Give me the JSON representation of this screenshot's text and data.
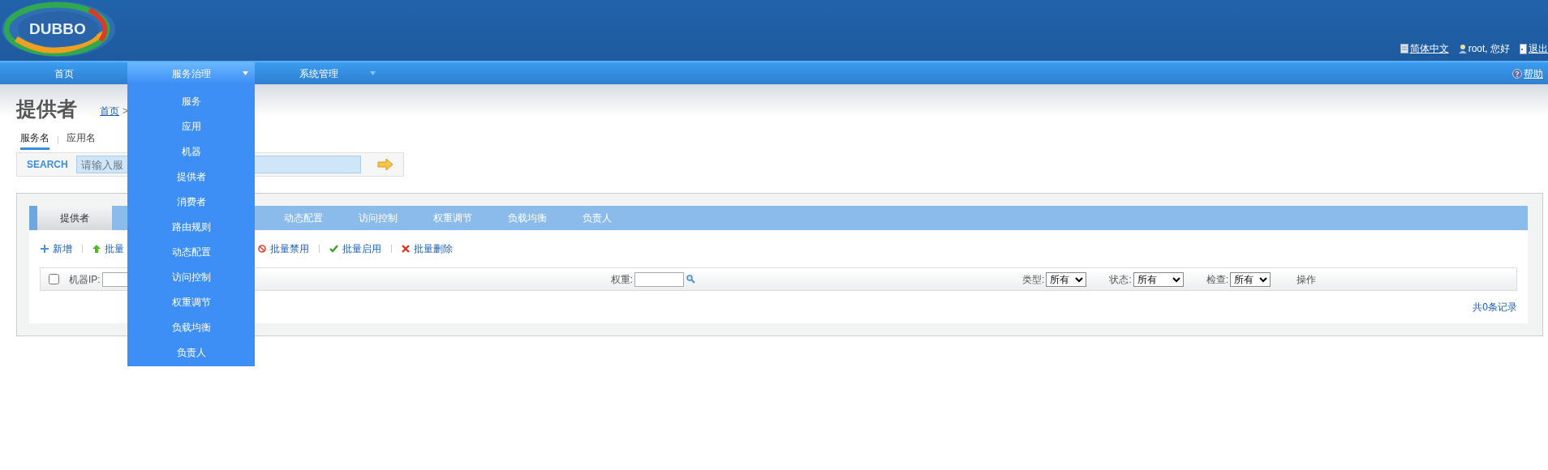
{
  "logo": {
    "text": "DUBBO"
  },
  "header_links": [
    {
      "kind": "doc",
      "label": "简体中文",
      "link": true
    },
    {
      "kind": "user",
      "label": "root, 您好",
      "link": false
    },
    {
      "kind": "exit",
      "label": "退出",
      "link": true
    }
  ],
  "nav": [
    {
      "label": "首页",
      "selected": false,
      "has_menu": false
    },
    {
      "label": "服务治理",
      "selected": true,
      "has_menu": true
    },
    {
      "label": "系统管理",
      "selected": false,
      "has_menu": true
    }
  ],
  "help": "帮助",
  "dropdown": [
    "服务",
    "应用",
    "机器",
    "提供者",
    "消费者",
    "路由规则",
    "动态配置",
    "访问控制",
    "权重调节",
    "负载均衡",
    "负责人"
  ],
  "page_title": "提供者",
  "breadcrumb": {
    "home": "首页",
    "separator": ">"
  },
  "search": {
    "tabs": [
      {
        "label": "服务名",
        "selected": true
      },
      {
        "label": "应用名",
        "selected": false
      }
    ],
    "label": "SEARCH",
    "placeholder": "请输入服"
  },
  "tabs": [
    {
      "label": "提供者",
      "selected": true
    },
    {
      "label": "动态配置",
      "selected": false
    },
    {
      "label": "访问控制",
      "selected": false
    },
    {
      "label": "权重调节",
      "selected": false
    },
    {
      "label": "负载均衡",
      "selected": false
    },
    {
      "label": "负责人",
      "selected": false
    }
  ],
  "actions": [
    {
      "kind": "add",
      "label": "新增"
    },
    {
      "kind": "up",
      "label": "批量"
    },
    {
      "kind": "disable",
      "label": "批量禁用"
    },
    {
      "kind": "enable",
      "label": "批量启用"
    },
    {
      "kind": "delete",
      "label": "批量删除"
    }
  ],
  "filters": {
    "checked": false,
    "ip_label": "机器IP:",
    "weight_label": "权重:",
    "selects": [
      {
        "label": "类型:",
        "value": "所有"
      },
      {
        "label": "状态:",
        "value": "所有"
      },
      {
        "label": "检查:",
        "value": "所有"
      }
    ],
    "operation": "操作"
  },
  "record_count": "共0条记录"
}
